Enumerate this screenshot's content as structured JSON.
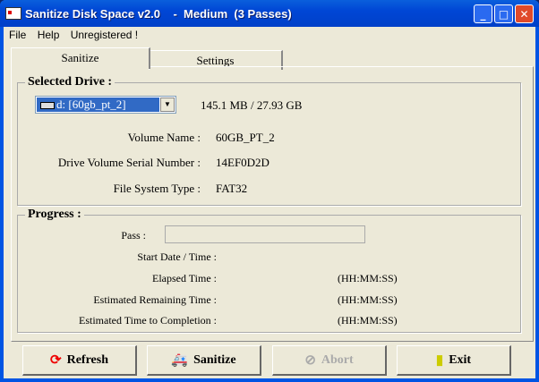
{
  "window": {
    "title": "Sanitize Disk Space v2.0    -  Medium  (3 Passes)"
  },
  "menu": [
    "File",
    "Help",
    "Unregistered !"
  ],
  "tabs": [
    "Sanitize",
    "Settings"
  ],
  "drive": {
    "legend": "Selected Drive :",
    "selected": "d: [60gb_pt_2]",
    "space": "145.1 MB / 27.93 GB",
    "volume_label": "Volume Name :",
    "volume": "60GB_PT_2",
    "serial_label": "Drive Volume Serial Number :",
    "serial": "14EF0D2D",
    "fs_label": "File System Type :",
    "fs": "FAT32"
  },
  "progress": {
    "legend": "Progress :",
    "pass_label": "Pass :",
    "start_label": "Start Date / Time :",
    "elapsed_label": "Elapsed Time :",
    "elapsed_unit": "(HH:MM:SS)",
    "remaining_label": "Estimated Remaining Time :",
    "remaining_unit": "(HH:MM:SS)",
    "completion_label": "Estimated Time to Completion :",
    "completion_unit": "(HH:MM:SS)"
  },
  "buttons": {
    "refresh": "Refresh",
    "sanitize": "Sanitize",
    "abort": "Abort",
    "exit": "Exit"
  }
}
